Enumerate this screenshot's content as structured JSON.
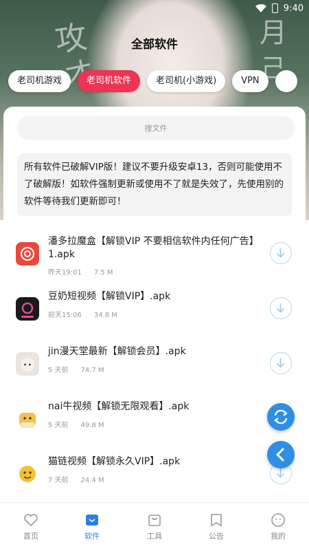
{
  "status": {
    "time": "9:40"
  },
  "header": {
    "title": "全部软件"
  },
  "tabs": [
    {
      "label": "老司机游戏",
      "active": false
    },
    {
      "label": "老司机软件",
      "active": true
    },
    {
      "label": "老司机(小游戏)",
      "active": false
    },
    {
      "label": "VPN",
      "active": false
    }
  ],
  "search": {
    "placeholder": "搜文件"
  },
  "notice": "所有软件已破解VIP版！建议不要升级安卓13，否则可能使用不了破解版！如软件强制更新或使用不了就是失效了，先使用别的软件等待我们更新即可！",
  "apps": [
    {
      "name": "潘多拉魔盒【解锁VIP 不要相信软件内任何广告】1.apk",
      "time": "昨天19:01",
      "size": "7.5 M",
      "icon": "pandora-icon",
      "color": "#e8493a"
    },
    {
      "name": "豆奶短视频【解锁VIP】.apk",
      "time": "前天15:06",
      "size": "34.8 M",
      "icon": "dounai-icon",
      "color": "#1a1a1a"
    },
    {
      "name": "jin漫天堂最新【解锁会员】.apk",
      "time": "5 天前",
      "size": "74.7 M",
      "icon": "anime-girl-icon",
      "color": "#e9e4df"
    },
    {
      "name": "nai牛视频【解锁无限观看】.apk",
      "time": "5 天前",
      "size": "49.8 M",
      "icon": "cow-icon",
      "color": "#f0c24a"
    },
    {
      "name": "猫链视频【解锁永久VIP】.apk",
      "time": "7 天前",
      "size": "24.4 M",
      "icon": "cat-icon",
      "color": "#f1c232"
    }
  ],
  "nav": [
    {
      "label": "首页",
      "icon": "heart-icon",
      "active": false
    },
    {
      "label": "软件",
      "icon": "software-icon",
      "active": true
    },
    {
      "label": "工具",
      "icon": "tool-bag-icon",
      "active": false
    },
    {
      "label": "公告",
      "icon": "bookmark-icon",
      "active": false
    },
    {
      "label": "我的",
      "icon": "smile-icon",
      "active": false
    }
  ]
}
